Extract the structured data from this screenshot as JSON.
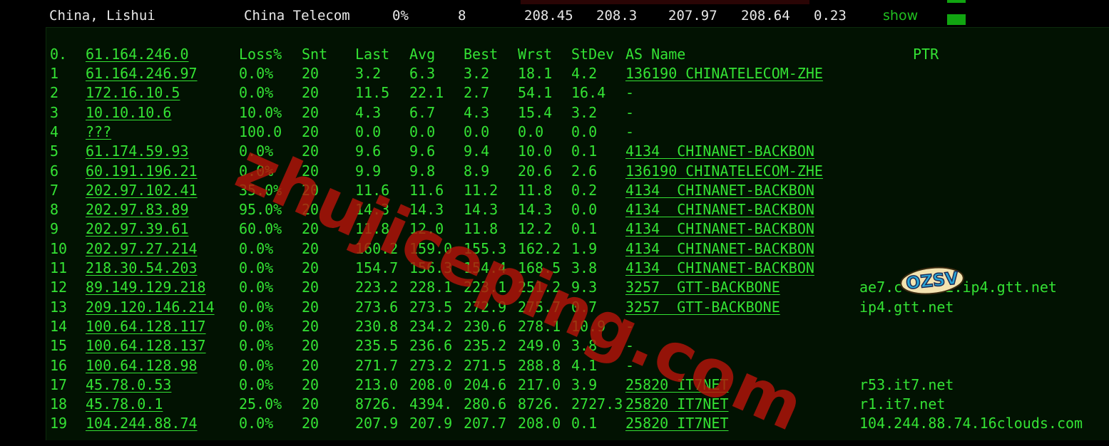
{
  "top": {
    "location": "China, Lishui",
    "isp": "China Telecom",
    "loss": "0%",
    "sent": "8",
    "last": "208.45",
    "avg": "208.3",
    "best": "207.97",
    "worst": "208.64",
    "stdev": "0.23",
    "show_label": "show"
  },
  "header": {
    "hop": "0.",
    "host": "61.164.246.0",
    "loss": "Loss%",
    "snt": "Snt",
    "last": "Last",
    "avg": "Avg",
    "best": "Best",
    "wrst": "Wrst",
    "stdev": "StDev",
    "as": "AS Name",
    "ptr": "PTR"
  },
  "hops": [
    {
      "hop": "1",
      "host": "61.164.246.97",
      "loss": "0.0%",
      "snt": "20",
      "last": "3.2",
      "avg": "6.3",
      "best": "3.2",
      "wrst": "18.1",
      "stdev": "4.2",
      "as": "136190 CHINATELECOM-ZHE",
      "ptr": ""
    },
    {
      "hop": "2",
      "host": "172.16.10.5",
      "loss": "0.0%",
      "snt": "20",
      "last": "11.5",
      "avg": "22.1",
      "best": "2.7",
      "wrst": "54.1",
      "stdev": "16.4",
      "as": "-",
      "ptr": ""
    },
    {
      "hop": "3",
      "host": "10.10.10.6",
      "loss": "10.0%",
      "snt": "20",
      "last": "4.3",
      "avg": "6.7",
      "best": "4.3",
      "wrst": "15.4",
      "stdev": "3.2",
      "as": "-",
      "ptr": ""
    },
    {
      "hop": "4",
      "host": "???",
      "loss": "100.0",
      "snt": "20",
      "last": "0.0",
      "avg": "0.0",
      "best": "0.0",
      "wrst": "0.0",
      "stdev": "0.0",
      "as": "-",
      "ptr": ""
    },
    {
      "hop": "5",
      "host": "61.174.59.93",
      "loss": "0.0%",
      "snt": "20",
      "last": "9.6",
      "avg": "9.6",
      "best": "9.4",
      "wrst": "10.0",
      "stdev": "0.1",
      "as": "4134  CHINANET-BACKBON",
      "ptr": ""
    },
    {
      "hop": "6",
      "host": "60.191.196.21",
      "loss": "0.0%",
      "snt": "20",
      "last": "9.9",
      "avg": "9.8",
      "best": "8.9",
      "wrst": "20.6",
      "stdev": "2.6",
      "as": "136190 CHINATELECOM-ZHE",
      "ptr": ""
    },
    {
      "hop": "7",
      "host": "202.97.102.41",
      "loss": "35.0%",
      "snt": "20",
      "last": "11.6",
      "avg": "11.6",
      "best": "11.2",
      "wrst": "11.8",
      "stdev": "0.2",
      "as": "4134  CHINANET-BACKBON",
      "ptr": ""
    },
    {
      "hop": "8",
      "host": "202.97.83.89",
      "loss": "95.0%",
      "snt": "20",
      "last": "14.3",
      "avg": "14.3",
      "best": "14.3",
      "wrst": "14.3",
      "stdev": "0.0",
      "as": "4134  CHINANET-BACKBON",
      "ptr": ""
    },
    {
      "hop": "9",
      "host": "202.97.39.61",
      "loss": "60.0%",
      "snt": "20",
      "last": "11.8",
      "avg": "12.0",
      "best": "11.8",
      "wrst": "12.2",
      "stdev": "0.1",
      "as": "4134  CHINANET-BACKBON",
      "ptr": ""
    },
    {
      "hop": "10",
      "host": "202.97.27.214",
      "loss": "0.0%",
      "snt": "20",
      "last": "160.2",
      "avg": "159.0",
      "best": "155.3",
      "wrst": "162.2",
      "stdev": "1.9",
      "as": "4134  CHINANET-BACKBON",
      "ptr": ""
    },
    {
      "hop": "11",
      "host": "218.30.54.203",
      "loss": "0.0%",
      "snt": "20",
      "last": "154.7",
      "avg": "156.3",
      "best": "154.4",
      "wrst": "168.5",
      "stdev": "3.8",
      "as": "4134  CHINANET-BACKBON",
      "ptr": ""
    },
    {
      "hop": "12",
      "host": "89.149.129.218",
      "loss": "0.0%",
      "snt": "20",
      "last": "223.2",
      "avg": "228.1",
      "best": "223.1",
      "wrst": "251.2",
      "stdev": "9.3",
      "as": "3257  GTT-BACKBONE",
      "ptr": "ae7.c     2.ip4.gtt.net"
    },
    {
      "hop": "13",
      "host": "209.120.146.214",
      "loss": "0.0%",
      "snt": "20",
      "last": "273.6",
      "avg": "273.5",
      "best": "272.9",
      "wrst": "275.7",
      "stdev": "0.7",
      "as": "3257  GTT-BACKBONE",
      "ptr": "ip4.gtt.net"
    },
    {
      "hop": "14",
      "host": "100.64.128.117",
      "loss": "0.0%",
      "snt": "20",
      "last": "230.8",
      "avg": "234.2",
      "best": "230.6",
      "wrst": "278.1",
      "stdev": "10.9",
      "as": "-",
      "ptr": ""
    },
    {
      "hop": "15",
      "host": "100.64.128.137",
      "loss": "0.0%",
      "snt": "20",
      "last": "235.5",
      "avg": "236.6",
      "best": "235.2",
      "wrst": "249.0",
      "stdev": "3.8",
      "as": "-",
      "ptr": ""
    },
    {
      "hop": "16",
      "host": "100.64.128.98",
      "loss": "0.0%",
      "snt": "20",
      "last": "271.7",
      "avg": "273.2",
      "best": "271.5",
      "wrst": "288.8",
      "stdev": "4.1",
      "as": "-",
      "ptr": ""
    },
    {
      "hop": "17",
      "host": "45.78.0.53",
      "loss": "0.0%",
      "snt": "20",
      "last": "213.0",
      "avg": "208.0",
      "best": "204.6",
      "wrst": "217.0",
      "stdev": "3.9",
      "as": "25820 IT7NET",
      "ptr": "r53.it7.net"
    },
    {
      "hop": "18",
      "host": "45.78.0.1",
      "loss": "25.0%",
      "snt": "20",
      "last": "8726.",
      "avg": "4394.",
      "best": "280.6",
      "wrst": "8726.",
      "stdev": "2727.3",
      "as": "25820 IT7NET",
      "ptr": "r1.it7.net"
    },
    {
      "hop": "19",
      "host": "104.244.88.74",
      "loss": "0.0%",
      "snt": "20",
      "last": "207.9",
      "avg": "207.9",
      "best": "207.7",
      "wrst": "208.0",
      "stdev": "0.1",
      "as": "25820 IT7NET",
      "ptr": "104.244.88.74.16clouds.com"
    }
  ],
  "watermark": "zhujiceping.com",
  "logo_text": "OZSV",
  "colors": {
    "text_green": "#34e234",
    "panel_bg": "#021202",
    "status_green": "#11a511",
    "watermark_red": "#b4140a"
  }
}
